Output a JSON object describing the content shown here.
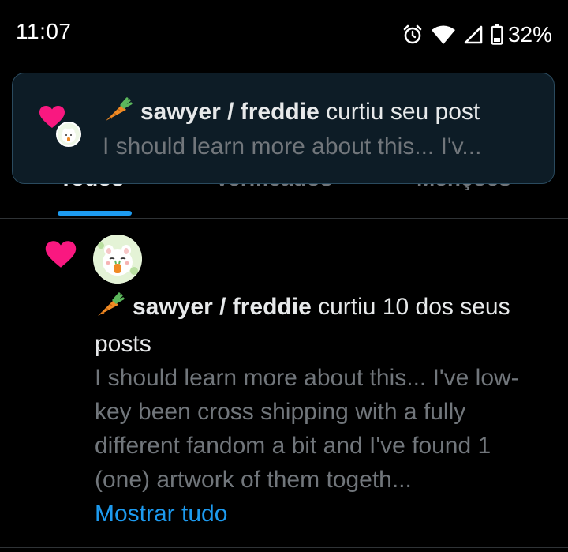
{
  "status_bar": {
    "time": "11:07",
    "battery": "32%",
    "icons": [
      "alarm-icon",
      "wifi-icon",
      "cellular-signal-icon",
      "battery-icon"
    ]
  },
  "tabs": [
    {
      "label": "Todos",
      "active": true
    },
    {
      "label": "Verificados",
      "active": false
    },
    {
      "label": "Menções",
      "active": false
    }
  ],
  "toast": {
    "user_name": "sawyer / freddie",
    "action": "curtiu seu post",
    "snippet": "I should learn more about this... I'v..."
  },
  "notification": {
    "user_name": "sawyer / freddie",
    "action": "curtiu 10 dos seus posts",
    "snippet": "I should learn more about this... I've low-key been cross shipping with a fully different fandom a bit and I've found 1 (one) artwork of them togeth...",
    "show_all": "Mostrar tudo"
  },
  "colors": {
    "background": "#000000",
    "heart": "#f91880",
    "accent": "#1d9bf0",
    "muted_text": "#71767b",
    "primary_text": "#e7e9ea",
    "toast_bg": "#0d1c26"
  }
}
